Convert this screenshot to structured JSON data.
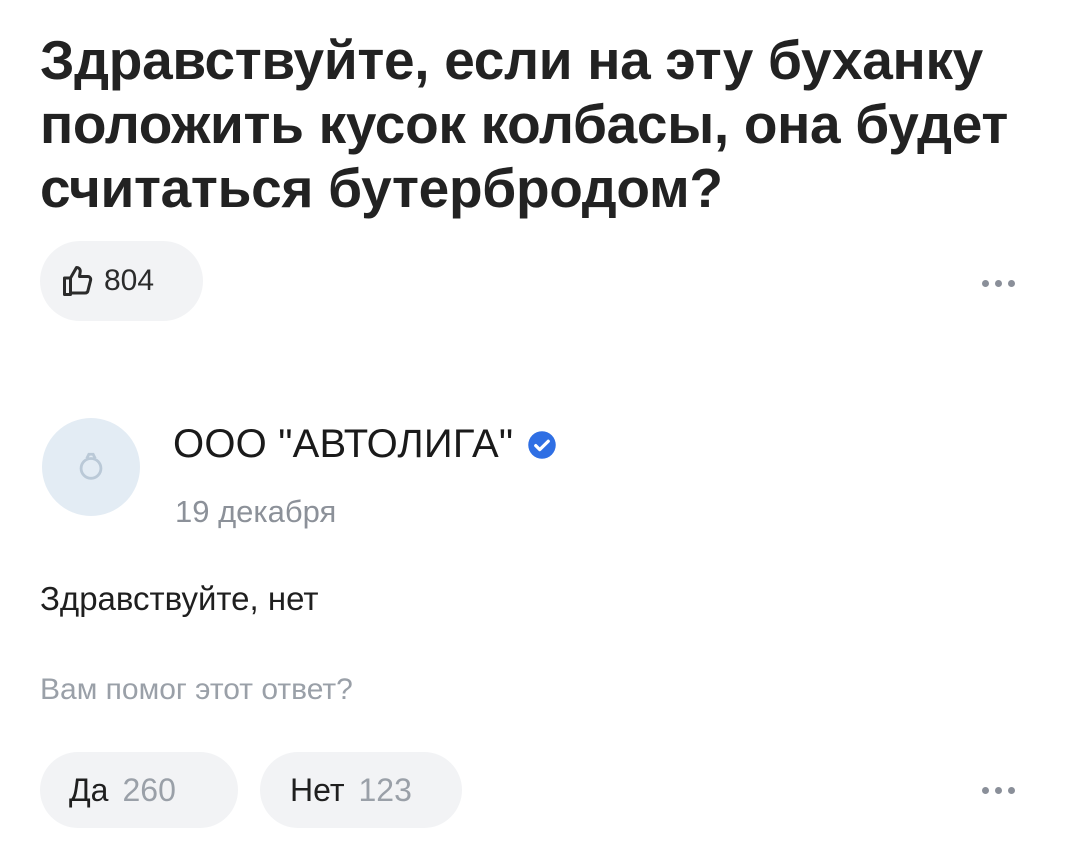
{
  "question": {
    "title": "Здравствуйте, если на эту буханку положить кусок колбасы, она будет считаться бутербродом?",
    "likes": "804"
  },
  "answer": {
    "author": "ООО \"АВТОЛИГА\"",
    "verified": true,
    "date": "19 декабря",
    "text": "Здравствуйте, нет",
    "helpful_question": "Вам помог этот ответ?",
    "vote_yes_label": "Да",
    "vote_yes_count": "260",
    "vote_no_label": "Нет",
    "vote_no_count": "123"
  },
  "icons": {
    "like": "thumbs-up-icon",
    "more": "more-dots-icon",
    "verified": "verified-check-icon",
    "avatar": "avatar-placeholder-icon"
  },
  "colors": {
    "background": "#ffffff",
    "pill_background": "#f2f3f5",
    "verified_blue": "#2f6fe4",
    "muted_text": "#9aa0a8",
    "avatar_background": "#e3ecf4"
  }
}
